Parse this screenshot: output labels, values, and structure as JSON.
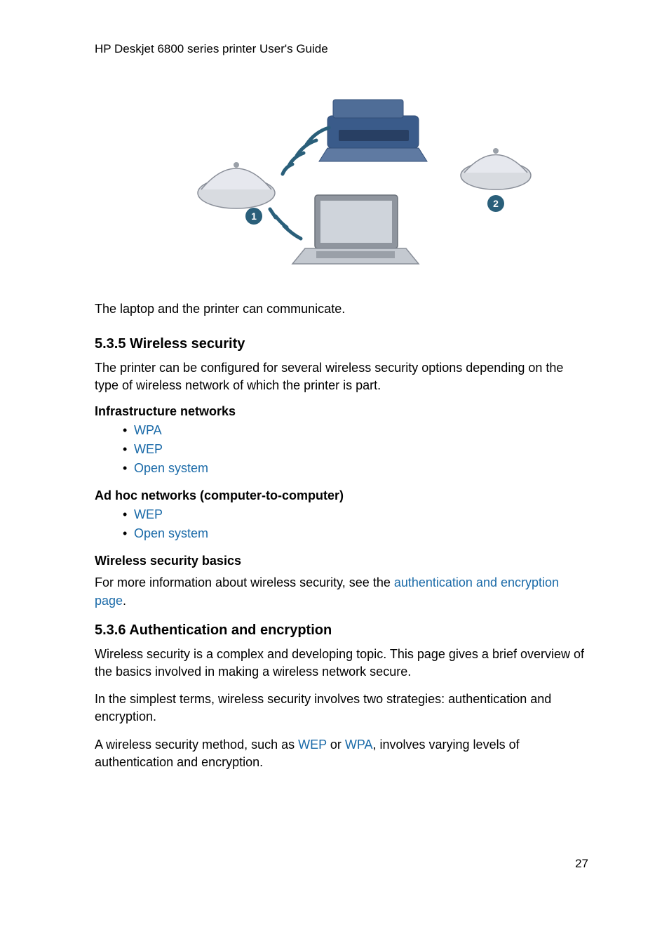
{
  "header": "HP Deskjet 6800 series printer User's Guide",
  "figure": {
    "label1": "1",
    "label2": "2"
  },
  "caption": "The laptop and the printer can communicate.",
  "section535_title": "5.3.5  Wireless security",
  "section535_para": "The printer can be configured for several wireless security options depending on the type of wireless network of which the printer is part.",
  "infra_heading": "Infrastructure networks",
  "infra_items": {
    "wpa": "WPA",
    "wep": "WEP",
    "open": "Open system"
  },
  "adhoc_heading": "Ad hoc networks (computer-to-computer)",
  "adhoc_items": {
    "wep": "WEP",
    "open": "Open system"
  },
  "basics_heading": "Wireless security basics",
  "basics_para_pre": "For more information about wireless security, see the ",
  "basics_link": "authentication and encryption page",
  "basics_para_post": ".",
  "section536_title": "5.3.6  Authentication and encryption",
  "section536_p1": "Wireless security is a complex and developing topic. This page gives a brief overview of the basics involved in making a wireless network secure.",
  "section536_p2": "In the simplest terms, wireless security involves two strategies: authentication and encryption.",
  "section536_p3_pre": "A wireless security method, such as ",
  "section536_p3_link1": "WEP",
  "section536_p3_mid": " or ",
  "section536_p3_link2": "WPA",
  "section536_p3_post": ", involves varying levels of authentication and encryption.",
  "page_number": "27"
}
